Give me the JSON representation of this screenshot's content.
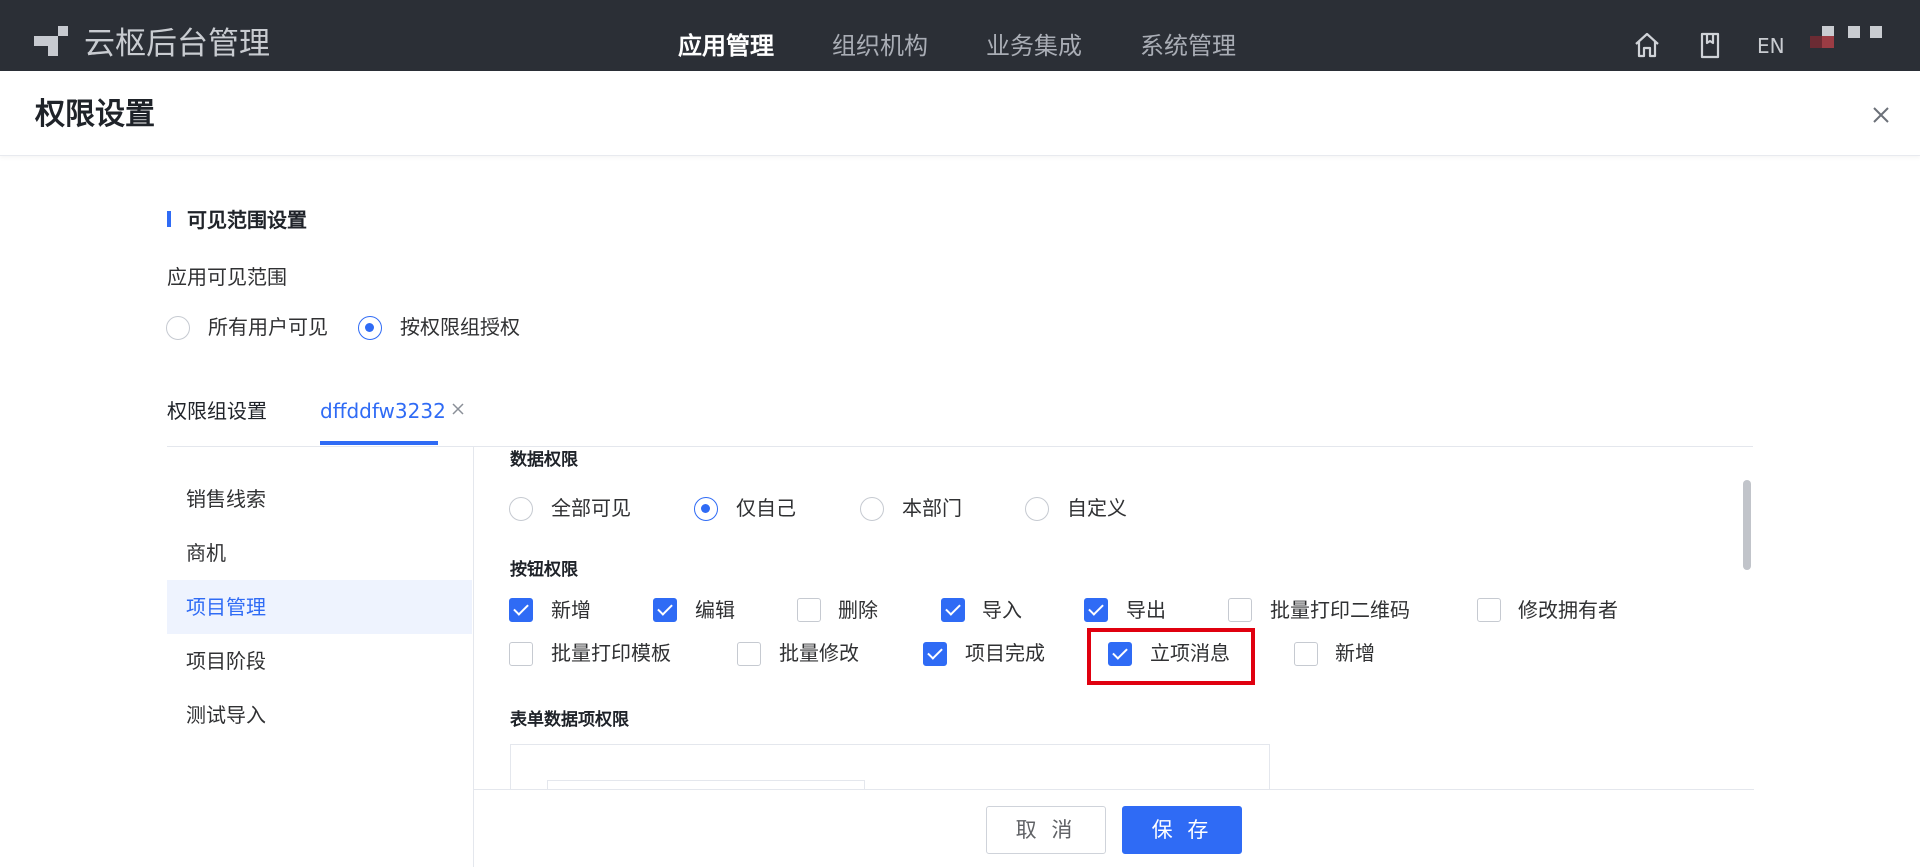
{
  "topbar": {
    "app_title": "云枢后台管理",
    "nav": [
      "应用管理",
      "组织机构",
      "业务集成",
      "系统管理"
    ],
    "active_nav": "应用管理",
    "icons": [
      "home-icon",
      "book-icon"
    ],
    "lang": "EN"
  },
  "page": {
    "title": "权限设置"
  },
  "visibility": {
    "section_title": "可见范围设置",
    "field_label": "应用可见范围",
    "options": [
      "所有用户可见",
      "按权限组授权"
    ],
    "selected": "按权限组授权"
  },
  "tabs": {
    "items": [
      "权限组设置",
      "dffddfw3232"
    ],
    "active": "dffddfw3232"
  },
  "left_list": {
    "items": [
      "销售线索",
      "商机",
      "项目管理",
      "项目阶段",
      "测试导入"
    ],
    "active": "项目管理"
  },
  "data_permission": {
    "title": "数据权限",
    "options": [
      "全部可见",
      "仅自己",
      "本部门",
      "自定义"
    ],
    "selected": "仅自己"
  },
  "button_permission": {
    "title": "按钮权限",
    "items": [
      {
        "label": "新增",
        "checked": true
      },
      {
        "label": "编辑",
        "checked": true
      },
      {
        "label": "删除",
        "checked": false
      },
      {
        "label": "导入",
        "checked": true
      },
      {
        "label": "导出",
        "checked": true
      },
      {
        "label": "批量打印二维码",
        "checked": false
      },
      {
        "label": "修改拥有者",
        "checked": false
      },
      {
        "label": "批量打印模板",
        "checked": false
      },
      {
        "label": "批量修改",
        "checked": false
      },
      {
        "label": "项目完成",
        "checked": true
      },
      {
        "label": "立项消息",
        "checked": true
      },
      {
        "label": "新增",
        "checked": false
      }
    ],
    "highlighted": "立项消息"
  },
  "form_permission": {
    "title": "表单数据项权限"
  },
  "footer": {
    "cancel_label": "取 消",
    "save_label": "保 存"
  },
  "colors": {
    "primary": "#2f6bf5",
    "topbar_bg": "#2b2f36",
    "highlight": "#e0000f"
  }
}
